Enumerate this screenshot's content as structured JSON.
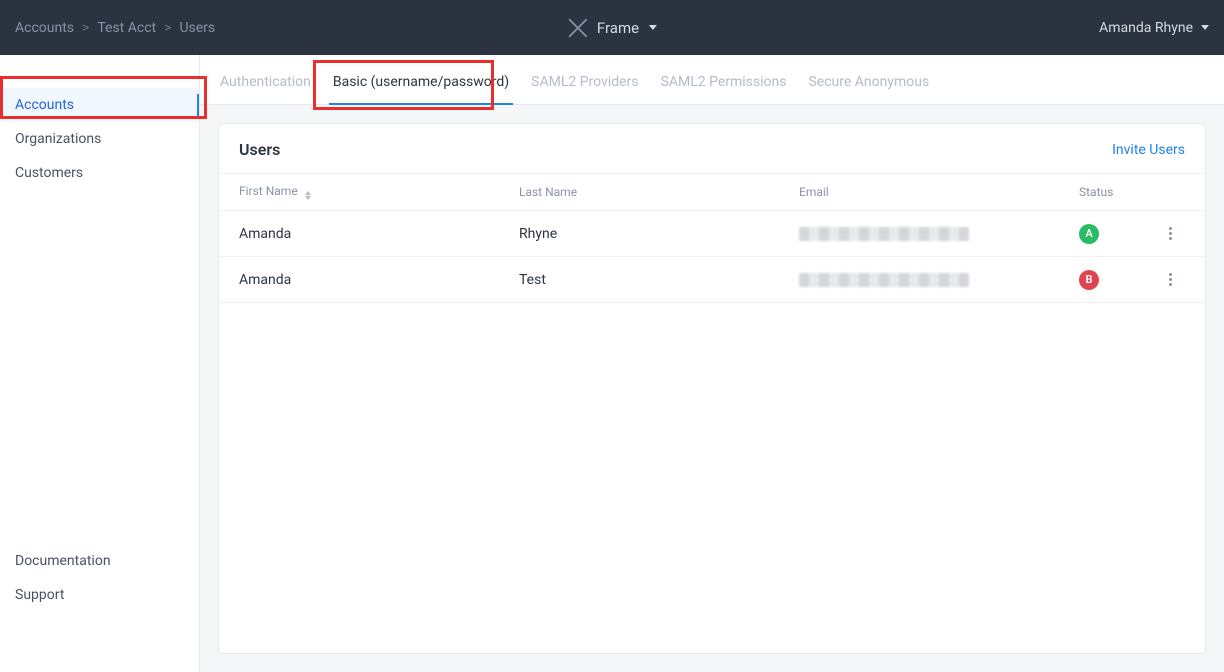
{
  "topbar": {
    "breadcrumb": [
      "Accounts",
      "Test Acct",
      "Users"
    ],
    "app_name": "Frame",
    "user_name": "Amanda Rhyne"
  },
  "sidebar": {
    "main_items": [
      {
        "label": "Accounts",
        "active": true
      },
      {
        "label": "Organizations",
        "active": false
      },
      {
        "label": "Customers",
        "active": false
      }
    ],
    "footer_items": [
      {
        "label": "Documentation"
      },
      {
        "label": "Support"
      }
    ]
  },
  "tabs": [
    {
      "label": "Authentication",
      "active": false
    },
    {
      "label": "Basic (username/password)",
      "active": true
    },
    {
      "label": "SAML2 Providers",
      "active": false
    },
    {
      "label": "SAML2 Permissions",
      "active": false
    },
    {
      "label": "Secure Anonymous",
      "active": false
    }
  ],
  "panel": {
    "title": "Users",
    "invite_label": "Invite Users",
    "columns": {
      "first": "First Name",
      "last": "Last Name",
      "email": "Email",
      "status": "Status"
    },
    "rows": [
      {
        "first": "Amanda",
        "last": "Rhyne",
        "status_letter": "A",
        "status_color": "green"
      },
      {
        "first": "Amanda",
        "last": "Test",
        "status_letter": "B",
        "status_color": "red"
      }
    ]
  }
}
